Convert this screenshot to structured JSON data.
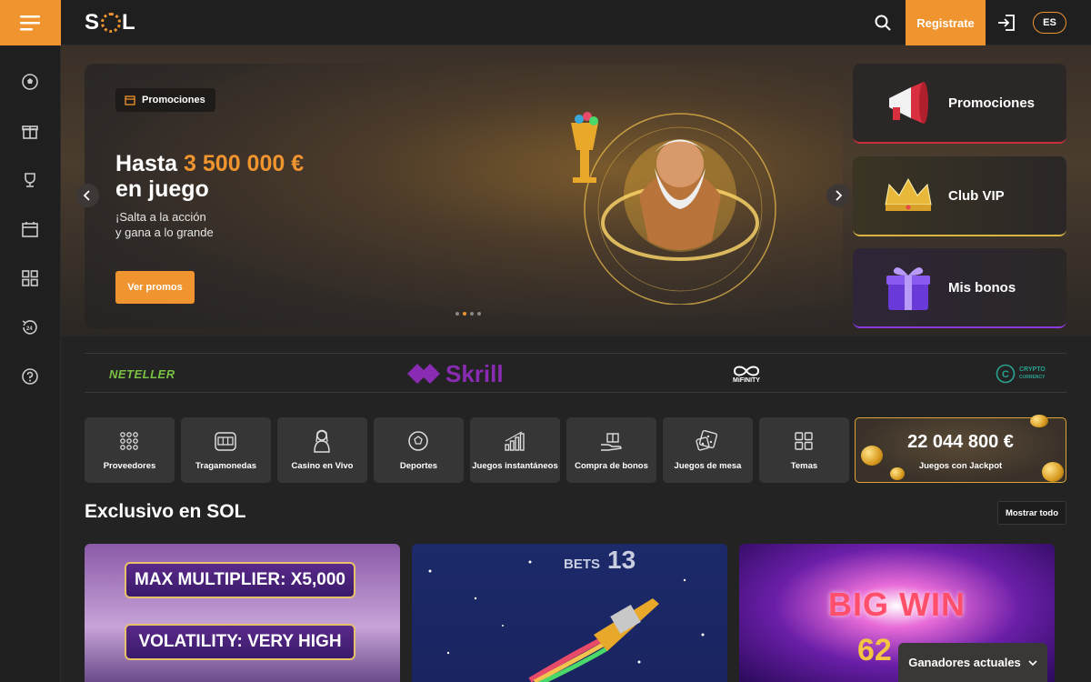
{
  "header": {
    "logo_text": "SOL",
    "register_label": "Registrate",
    "language": "ES",
    "icons": [
      "hamburger-menu-icon",
      "search-icon",
      "login-icon"
    ]
  },
  "sidebar": {
    "items": [
      {
        "icon": "soccer-ball-icon"
      },
      {
        "icon": "gift-icon"
      },
      {
        "icon": "trophy-icon"
      },
      {
        "icon": "calendar-icon"
      },
      {
        "icon": "grid-icon"
      },
      {
        "icon": "support-24-icon"
      },
      {
        "icon": "help-icon"
      }
    ]
  },
  "hero": {
    "tag": "Promociones",
    "title_prefix": "Hasta ",
    "title_amount": "3 500 000 €",
    "title_suffix": "en juego",
    "subtitle_line1": "¡Salta a la acción",
    "subtitle_line2": "y gana a lo grande",
    "cta": "Ver promos",
    "slides_count": 4,
    "active_slide": 2
  },
  "side_cards": [
    {
      "label": "Promociones",
      "icon": "megaphone-icon"
    },
    {
      "label": "Club VIP",
      "icon": "crown-icon"
    },
    {
      "label": "Mis bonos",
      "icon": "gift-box-icon"
    }
  ],
  "payments": {
    "neteller": "NETELLER",
    "skrill": "Skrill",
    "mifinity": "MiFINITY",
    "crypto_line1": "CRYPTO",
    "crypto_line2": "CURRENCY"
  },
  "categories": [
    {
      "label": "Proveedores",
      "icon": "dots-grid-icon"
    },
    {
      "label": "Tragamonedas",
      "icon": "slot-machine-icon"
    },
    {
      "label": "Casino en Vivo",
      "icon": "live-dealer-icon"
    },
    {
      "label": "Deportes",
      "icon": "soccer-ball-icon"
    },
    {
      "label": "Juegos instantáneos",
      "icon": "chart-bars-icon"
    },
    {
      "label": "Compra de bonos",
      "icon": "bonus-hand-icon"
    },
    {
      "label": "Juegos de mesa",
      "icon": "dice-icon"
    },
    {
      "label": "Temas",
      "icon": "grid-icon"
    }
  ],
  "jackpot": {
    "value": "22 044 800 €",
    "label": "Juegos con Jackpot"
  },
  "section": {
    "title": "Exclusivo en SOL",
    "show_all": "Mostrar todo"
  },
  "games": [
    {
      "line1": "MAX MULTIPLIER: X5,000",
      "line2": "VOLATILITY: VERY HIGH"
    },
    {
      "bets_label": "BETS",
      "bets_value": "13"
    },
    {
      "bigwin": "BIG WIN",
      "number": "62"
    }
  ],
  "winners": {
    "label": "Ganadores actuales"
  },
  "colors": {
    "accent": "#f0942f",
    "background": "#232323",
    "tile": "#363636"
  }
}
